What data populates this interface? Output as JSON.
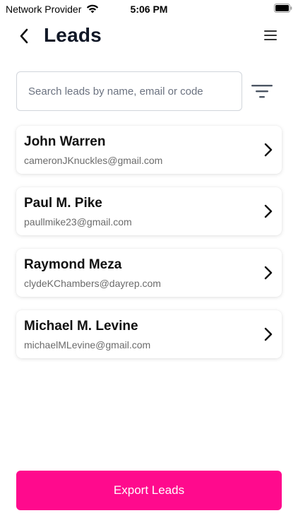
{
  "status_bar": {
    "carrier": "Network Provider",
    "time": "5:06 PM",
    "wifi_icon": "wifi-icon",
    "battery_icon": "battery-icon"
  },
  "header": {
    "title": "Leads",
    "back_icon": "chevron-left-icon",
    "menu_icon": "hamburger-menu-icon"
  },
  "search": {
    "placeholder": "Search leads by name, email or code",
    "value": "",
    "filter_icon": "filter-icon"
  },
  "leads": [
    {
      "name": "John Warren",
      "email": "cameronJKnuckles@gmail.com"
    },
    {
      "name": "Paul M. Pike",
      "email": "paullmike23@gmail.com"
    },
    {
      "name": "Raymond Meza",
      "email": "clydeKChambers@dayrep.com"
    },
    {
      "name": "Michael M. Levine",
      "email": "michaelMLevine@gmail.com"
    }
  ],
  "footer": {
    "export_label": "Export Leads"
  },
  "colors": {
    "accent": "#ff0a8d",
    "title": "#111827",
    "secondary_text": "#6b6b6b"
  }
}
